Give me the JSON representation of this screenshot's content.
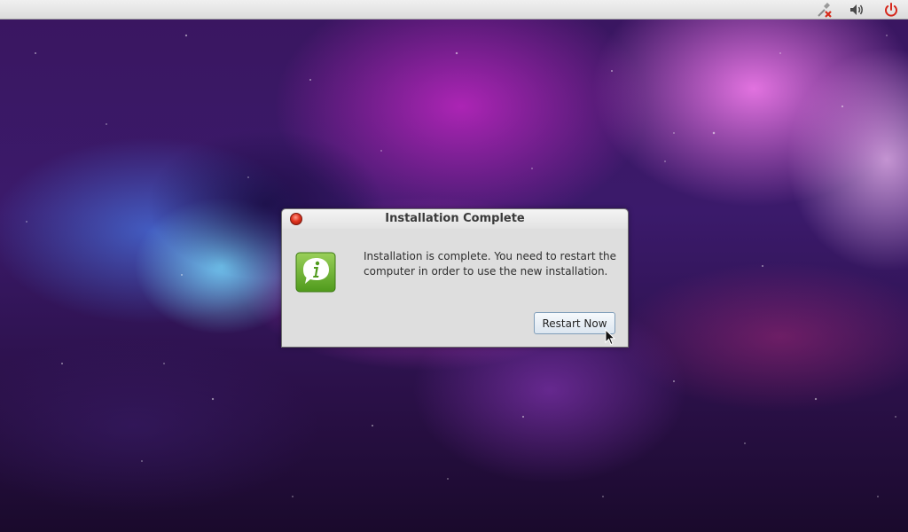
{
  "dialog": {
    "title": "Installation Complete",
    "message": "Installation is complete. You need to restart the computer in order to use the new installation.",
    "restart_button_label": "Restart Now"
  },
  "tray": {
    "icons": [
      "network-disconnected-icon",
      "volume-icon",
      "power-icon"
    ]
  },
  "colors": {
    "panel": "#dcdcdc",
    "dialog_bg": "#dedede",
    "info_icon_green": "#6ab42a",
    "close_button_red": "#e0341f",
    "power_icon_red": "#d6281c"
  }
}
